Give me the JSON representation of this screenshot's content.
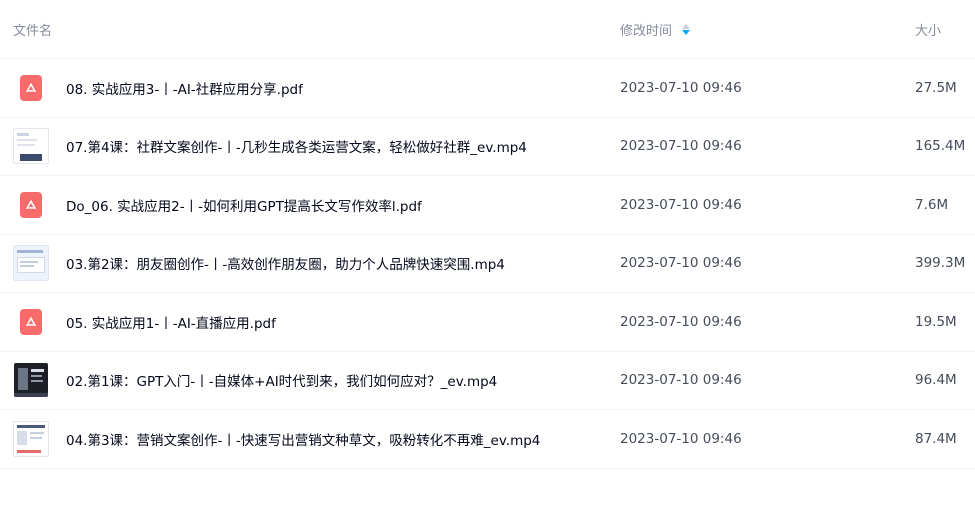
{
  "header": {
    "name_label": "文件名",
    "time_label": "修改时间",
    "size_label": "大小"
  },
  "files": [
    {
      "name": "08. 实战应用3-丨-AI-社群应用分享.pdf",
      "time": "2023-07-10 09:46",
      "size": "27.5M",
      "icon": "pdf-icon"
    },
    {
      "name": "07.第4课：社群文案创作-丨-几秒生成各类运营文案，轻松做好社群_ev.mp4",
      "time": "2023-07-10 09:46",
      "size": "165.4M",
      "icon": "video-thumbnail"
    },
    {
      "name": "Do_06. 实战应用2-丨-如何利用GPT提高长文写作效率l.pdf",
      "time": "2023-07-10 09:46",
      "size": "7.6M",
      "icon": "pdf-icon"
    },
    {
      "name": "03.第2课：朋友圈创作-丨-高效创作朋友圈，助力个人品牌快速突围.mp4",
      "time": "2023-07-10 09:46",
      "size": "399.3M",
      "icon": "video-thumbnail"
    },
    {
      "name": "05. 实战应用1-丨-AI-直播应用.pdf",
      "time": "2023-07-10 09:46",
      "size": "19.5M",
      "icon": "pdf-icon"
    },
    {
      "name": "02.第1课：GPT入门-丨-自媒体+AI时代到来，我们如何应对？_ev.mp4",
      "time": "2023-07-10 09:46",
      "size": "96.4M",
      "icon": "video-thumbnail"
    },
    {
      "name": "04.第3课：营销文案创作-丨-快速写出营销文种草文，吸粉转化不再难_ev.mp4",
      "time": "2023-07-10 09:46",
      "size": "87.4M",
      "icon": "video-thumbnail"
    }
  ],
  "colors": {
    "pdf": "#f76b6b",
    "sort_active": "#06a7ff"
  }
}
